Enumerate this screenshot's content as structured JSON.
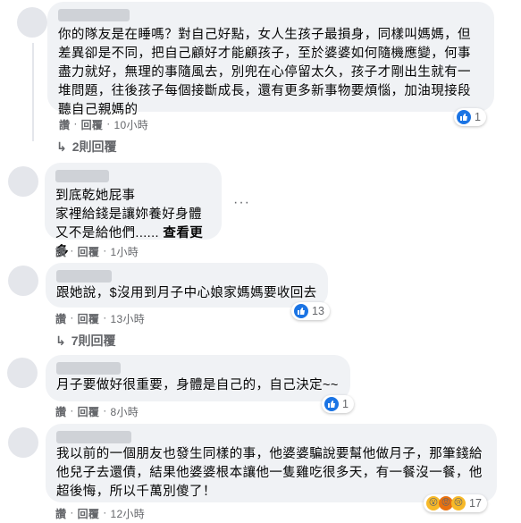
{
  "comments": [
    {
      "text": "你的隊友是在睡嗎？對自己好點，女人生孩子最損身，同樣叫媽媽，但差異卻是不同，把自己顧好才能顧孩子，至於婆婆如何隨機應變，何事盡力就好，無理的事隨風去，別兜在心停留太久，孩子才剛出生就有一堆問題，往後孩子每個接斷成長，還有更多新事物要煩惱，加油現接段聽自己親媽的",
      "actions": [
        "讚",
        "回覆"
      ],
      "time": "10小時",
      "reaction_count": "1",
      "reaction_icon": "like-icon",
      "replies_label": "2則回覆"
    },
    {
      "text_lines": [
        "到底乾她屁事",
        "家裡給錢是讓妳養好身體",
        "又不是給他們......"
      ],
      "see_more": "查看更多",
      "actions": [
        "讚",
        "回覆"
      ],
      "time": "1小時"
    },
    {
      "text": "跟她說，$沒用到月子中心娘家媽媽要收回去",
      "actions": [
        "讚",
        "回覆"
      ],
      "time": "13小時",
      "reaction_count": "13",
      "reaction_icon": "like-icon",
      "replies_label": "7則回覆"
    },
    {
      "text": "月子要做好很重要，身體是自己的，自己決定~~",
      "actions": [
        "讚",
        "回覆"
      ],
      "time": "8小時",
      "reaction_count": "1",
      "reaction_icon": "like-icon"
    },
    {
      "text": "我以前的一個朋友也發生同樣的事，他婆婆騙說要幫他做月子，那筆錢給他兒子去還債，結果他婆婆根本讓他一隻雞吃很多天，有一餐沒一餐，他超後悔，所以千萬別傻了！",
      "actions": [
        "讚",
        "回覆"
      ],
      "time": "12小時",
      "reaction_count": "17",
      "reaction_icons": [
        "wow-icon",
        "angry-icon",
        "sad-icon"
      ]
    }
  ],
  "separator": "·",
  "more_icon": "···",
  "reply_arrow": "↳",
  "colors": {
    "bubble": "#f0f2f5",
    "meta": "#65676b",
    "like": "#1b74e4"
  }
}
